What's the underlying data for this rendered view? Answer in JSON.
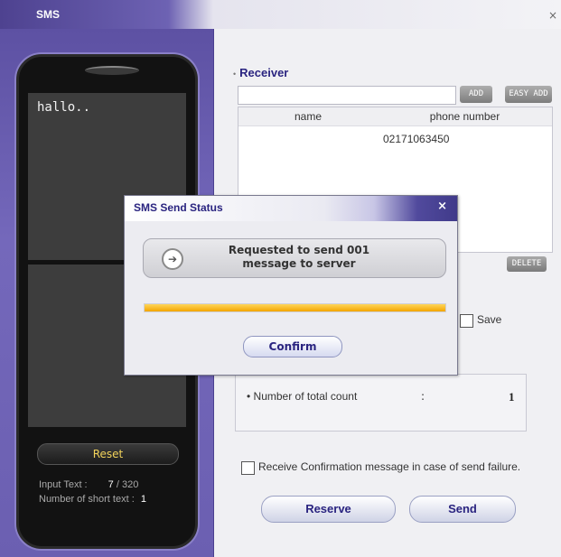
{
  "window": {
    "title": "SMS",
    "close_symbol": "×"
  },
  "phone": {
    "message_text": "hallo..",
    "reset_label": "Reset",
    "input_text_label": "Input Text :",
    "input_text_count": "7",
    "input_text_max": "/ 320",
    "short_text_label": "Number of short text :",
    "short_text_count": "1"
  },
  "receiver": {
    "label": "Receiver",
    "input_value": "",
    "add_label": "ADD",
    "easy_add_label": "EASY ADD",
    "columns": [
      "name",
      "phone number"
    ],
    "rows": [
      {
        "name": "",
        "phone": "02171063450"
      }
    ],
    "delete_label": "DELETE"
  },
  "options": {
    "save_label": "Save",
    "total_count_label": "Number of total count",
    "total_count_sep": ":",
    "total_count_value": "1",
    "confirm_failure_label": "Receive Confirmation message in case of send failure."
  },
  "actions": {
    "reserve_label": "Reserve",
    "send_label": "Send"
  },
  "dialog": {
    "title": "SMS Send Status",
    "close_symbol": "×",
    "message_line1": "Requested to send 001",
    "message_line2": "message to server",
    "progress": 1.0,
    "confirm_label": "Confirm"
  },
  "colors": {
    "accent": "#5d51a3",
    "title_text": "#2a2480",
    "progress": "#f3a400"
  }
}
